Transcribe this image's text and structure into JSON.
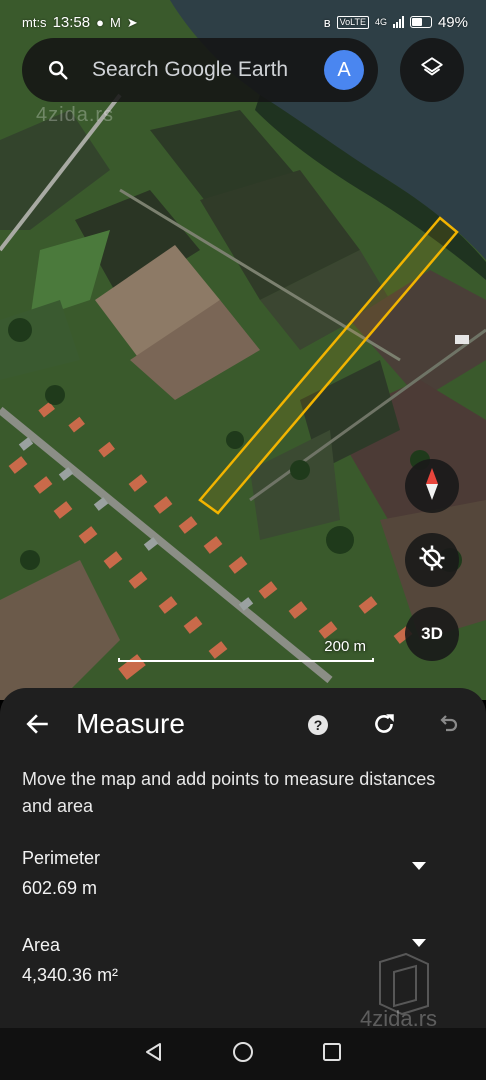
{
  "status_bar": {
    "carrier": "mt:s",
    "time": "13:58",
    "network_label": "VoLTE",
    "network_gen": "4G",
    "battery": "49%",
    "icons": [
      "message-icon",
      "gmail-icon",
      "location-icon",
      "bluetooth-icon",
      "signal-icon",
      "battery-icon"
    ]
  },
  "search": {
    "placeholder": "Search Google Earth",
    "avatar_initial": "A",
    "avatar_color": "#4a86f0"
  },
  "map": {
    "watermark": "4zida.rs",
    "scale_label": "200 m",
    "btn_3d": "3D",
    "polygon_color": "#f2b400",
    "controls": [
      "compass-icon",
      "location-off-icon",
      "3d-button"
    ]
  },
  "panel": {
    "title": "Measure",
    "instructions": "Move the map and add points to measure distances and area",
    "perimeter_label": "Perimeter",
    "perimeter_value": "602.69 m",
    "area_label": "Area",
    "area_value": "4,340.36 m²",
    "watermark": "4zida.rs"
  },
  "nav": [
    "back-triangle-icon",
    "home-circle-icon",
    "recents-square-icon"
  ]
}
